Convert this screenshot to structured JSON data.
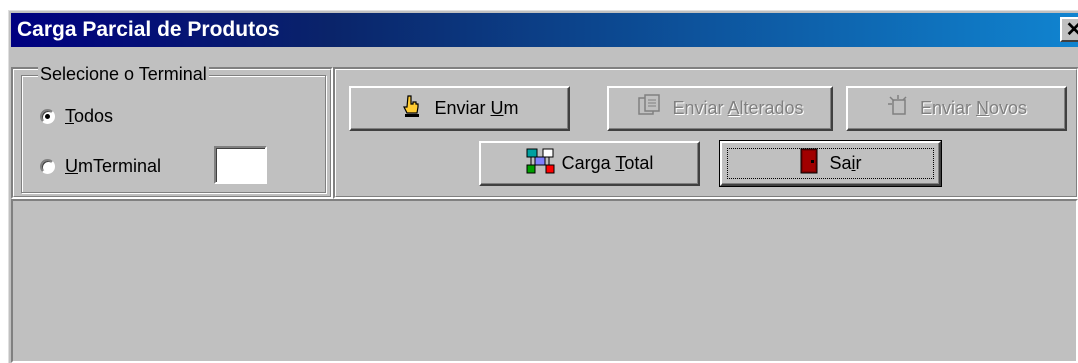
{
  "window": {
    "title": "Carga Parcial de Produtos",
    "close_symbol": "✕"
  },
  "terminal_group": {
    "legend": "Selecione o Terminal",
    "options": [
      {
        "first": "T",
        "rest": "odos",
        "checked": true
      },
      {
        "first": "U",
        "rest": "mTerminal",
        "checked": false
      }
    ],
    "terminal_value": ""
  },
  "buttons": {
    "enviar_um": {
      "pre": "Enviar ",
      "key": "U",
      "post": "m",
      "icon": "hand-pointer-icon",
      "enabled": true
    },
    "enviar_alterados": {
      "pre": "Enviar ",
      "key": "A",
      "post": "lterados",
      "icon": "modified-documents-icon",
      "enabled": false
    },
    "enviar_novos": {
      "pre": "Enviar ",
      "key": "N",
      "post": "ovos",
      "icon": "new-items-icon",
      "enabled": false
    },
    "carga_total": {
      "pre": "Carga ",
      "key": "T",
      "post": "otal",
      "icon": "network-transfer-icon",
      "enabled": true
    },
    "sair": {
      "pre": "Sa",
      "key": "i",
      "post": "r",
      "icon": "exit-door-icon",
      "enabled": true
    }
  }
}
